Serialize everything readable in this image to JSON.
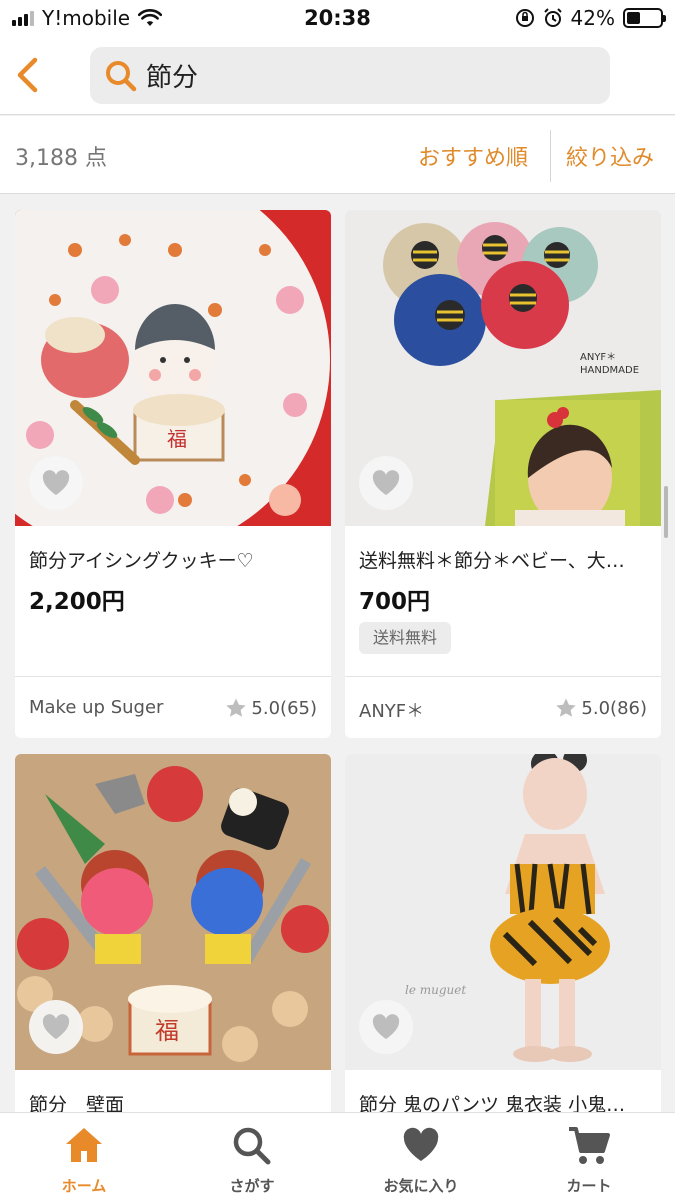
{
  "status_bar": {
    "carrier": "Y!mobile",
    "time": "20:38",
    "battery": "42%",
    "battery_level": 0.42
  },
  "header": {
    "back_icon": "chevron-left-icon",
    "search_icon": "search-icon",
    "search_query": "節分"
  },
  "results": {
    "count": "3,188 点",
    "sort_label": "おすすめ順",
    "filter_label": "絞り込み"
  },
  "products": [
    {
      "title": "節分アイシングクッキー♡",
      "price": "2,200円",
      "tag": "",
      "shop": "Make up Suger",
      "rating": "5.0(65)"
    },
    {
      "title": "送料無料＊節分＊ベビー、大…",
      "price": "700円",
      "tag": "送料無料",
      "shop": "ANYF＊",
      "rating": "5.0(86)",
      "image_text": "ANYF＊\nHANDMADE"
    },
    {
      "title": "節分　壁面",
      "image_text": "福"
    },
    {
      "title": "節分 鬼のパンツ 鬼衣装  小鬼…",
      "image_text": "le muguet"
    }
  ],
  "cookie_image_text": "福",
  "tab_bar": {
    "items": [
      {
        "label": "ホーム",
        "icon": "home-icon",
        "active": true
      },
      {
        "label": "さがす",
        "icon": "search-icon",
        "active": false
      },
      {
        "label": "お気に入り",
        "icon": "heart-icon",
        "active": false
      },
      {
        "label": "カート",
        "icon": "cart-icon",
        "active": false
      }
    ]
  },
  "colors": {
    "accent": "#e88a2a",
    "background": "#f1f1f1"
  }
}
